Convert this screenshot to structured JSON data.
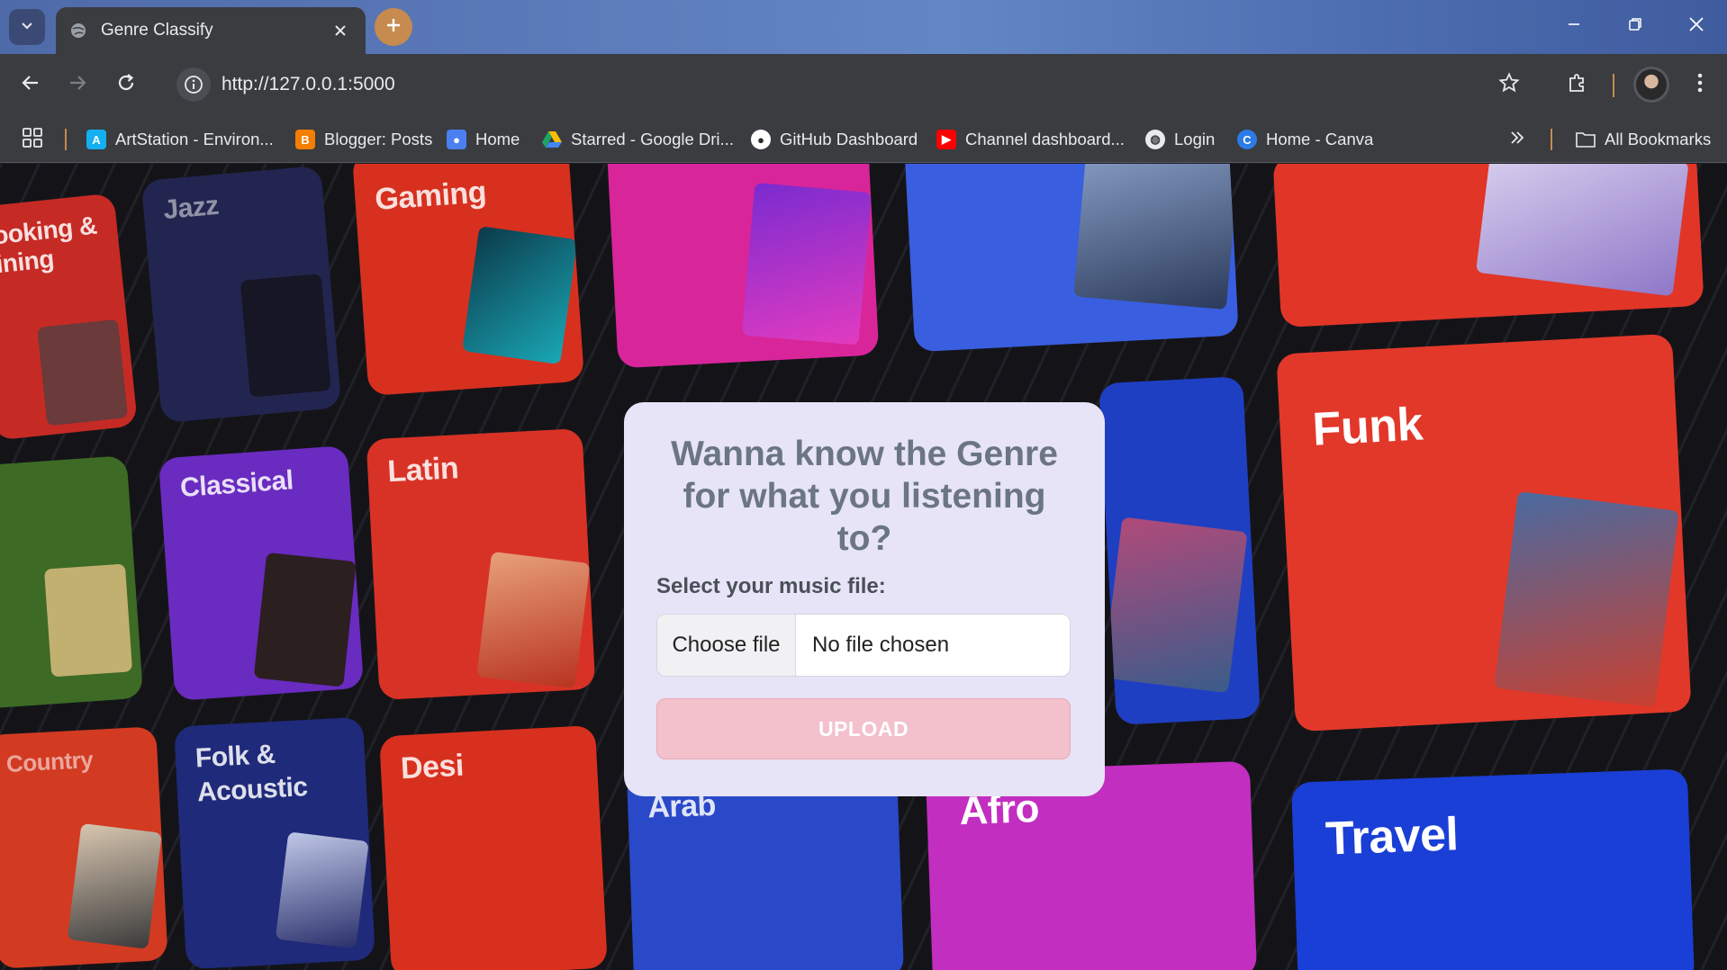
{
  "browser": {
    "tab_title": "Genre Classify",
    "url": "http://127.0.0.1:5000",
    "bookmarks": [
      {
        "label": "ArtStation - Environ...",
        "icon": "artstation-icon",
        "color": "#1e6bd6"
      },
      {
        "label": "Blogger: Posts",
        "icon": "blogger-icon",
        "color": "#f57d00"
      },
      {
        "label": "Home",
        "icon": "google-classroom-icon",
        "color": "#4a80f0"
      },
      {
        "label": "Starred - Google Dri...",
        "icon": "google-drive-icon",
        "color": "#1fa463"
      },
      {
        "label": "GitHub Dashboard",
        "icon": "github-icon",
        "color": "#ffffff"
      },
      {
        "label": "Channel dashboard...",
        "icon": "youtube-icon",
        "color": "#ff0000"
      },
      {
        "label": "Login",
        "icon": "globe-icon",
        "color": "#e8eaed"
      },
      {
        "label": "Home - Canva",
        "icon": "canva-icon",
        "color": "#2d7be5"
      }
    ],
    "all_bookmarks_label": "All Bookmarks"
  },
  "background_tiles": [
    {
      "label": "ooking &\nining",
      "color": "#c62a24"
    },
    {
      "label": "Jazz",
      "color": "#22254f"
    },
    {
      "label": "Gaming",
      "color": "#d7301f"
    },
    {
      "label": "Classical",
      "color": "#6a2bc0"
    },
    {
      "label": "Latin",
      "color": "#d83226"
    },
    {
      "label": "Funk",
      "color": "#e2382a"
    },
    {
      "label": "Country",
      "color": "#d23a22"
    },
    {
      "label": "Folk &\nAcoustic",
      "color": "#1f2a7a"
    },
    {
      "label": "Desi",
      "color": "#d8301e"
    },
    {
      "label": "Arab",
      "color": "#2a49c8"
    },
    {
      "label": "Afro",
      "color": "#c22ec0"
    },
    {
      "label": "Travel",
      "color": "#1a3fd6"
    }
  ],
  "card": {
    "title": "Wanna know the Genre for what you listening to?",
    "file_label": "Select your music file:",
    "choose_file_label": "Choose file",
    "file_status": "No file chosen",
    "upload_label": "UPLOAD"
  }
}
